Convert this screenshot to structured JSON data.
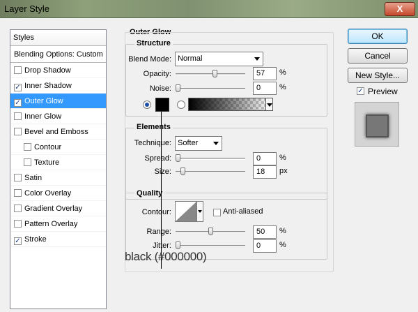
{
  "window": {
    "title": "Layer Style",
    "close_glyph": "X"
  },
  "styles_list": {
    "header": "Styles",
    "blending": "Blending Options: Custom",
    "items": [
      {
        "label": "Drop Shadow",
        "checked": false,
        "indent": false,
        "selected": false
      },
      {
        "label": "Inner Shadow",
        "checked": true,
        "indent": false,
        "selected": false
      },
      {
        "label": "Outer Glow",
        "checked": true,
        "indent": false,
        "selected": true
      },
      {
        "label": "Inner Glow",
        "checked": false,
        "indent": false,
        "selected": false
      },
      {
        "label": "Bevel and Emboss",
        "checked": false,
        "indent": false,
        "selected": false
      },
      {
        "label": "Contour",
        "checked": false,
        "indent": true,
        "selected": false
      },
      {
        "label": "Texture",
        "checked": false,
        "indent": true,
        "selected": false
      },
      {
        "label": "Satin",
        "checked": false,
        "indent": false,
        "selected": false
      },
      {
        "label": "Color Overlay",
        "checked": false,
        "indent": false,
        "selected": false
      },
      {
        "label": "Gradient Overlay",
        "checked": false,
        "indent": false,
        "selected": false
      },
      {
        "label": "Pattern Overlay",
        "checked": false,
        "indent": false,
        "selected": false
      },
      {
        "label": "Stroke",
        "checked": true,
        "indent": false,
        "selected": false
      }
    ],
    "check_glyph": "✓"
  },
  "outer_glow": {
    "title": "Outer Glow",
    "structure": {
      "legend": "Structure",
      "blend_mode_label": "Blend Mode:",
      "blend_mode_value": "Normal",
      "opacity_label": "Opacity:",
      "opacity_value": "57",
      "opacity_level": 0.57,
      "noise_label": "Noise:",
      "noise_value": "0",
      "noise_level": 0,
      "unit": "%",
      "color_mode": "solid",
      "glow_color": "#000000"
    },
    "elements": {
      "legend": "Elements",
      "technique_label": "Technique:",
      "technique_value": "Softer",
      "spread_label": "Spread:",
      "spread_value": "0",
      "spread_level": 0,
      "spread_unit": "%",
      "size_label": "Size:",
      "size_value": "18",
      "size_level": 0.07,
      "size_unit": "px"
    },
    "quality": {
      "legend": "Quality",
      "contour_label": "Contour:",
      "anti_aliased_label": "Anti-aliased",
      "anti_aliased": false,
      "range_label": "Range:",
      "range_value": "50",
      "range_level": 0.5,
      "jitter_label": "Jitter:",
      "jitter_value": "0",
      "jitter_level": 0,
      "unit": "%"
    }
  },
  "buttons": {
    "ok": "OK",
    "cancel": "Cancel",
    "new_style": "New Style...",
    "preview_label": "Preview",
    "preview_checked": true
  },
  "annotation": "black (#000000)"
}
